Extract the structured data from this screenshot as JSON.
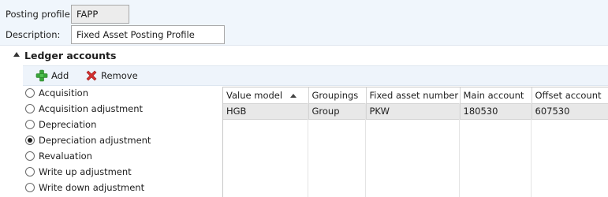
{
  "form": {
    "posting_profile_label": "Posting profile:",
    "posting_profile_value": "FAPP",
    "description_label": "Description:",
    "description_value": "Fixed Asset Posting Profile"
  },
  "section": {
    "title": "Ledger accounts"
  },
  "toolbar": {
    "add_label": "Add",
    "remove_label": "Remove"
  },
  "transaction_types": [
    {
      "label": "Acquisition",
      "selected": false
    },
    {
      "label": "Acquisition adjustment",
      "selected": false
    },
    {
      "label": "Depreciation",
      "selected": false
    },
    {
      "label": "Depreciation adjustment",
      "selected": true
    },
    {
      "label": "Revaluation",
      "selected": false
    },
    {
      "label": "Write up adjustment",
      "selected": false
    },
    {
      "label": "Write down adjustment",
      "selected": false
    }
  ],
  "grid": {
    "columns": [
      "Value model",
      "Groupings",
      "Fixed asset number",
      "Main account",
      "Offset account"
    ],
    "sorted_column": "Value model",
    "rows": [
      [
        "HGB",
        "Group",
        "PKW",
        "180530",
        "607530"
      ]
    ]
  },
  "colors": {
    "form_background": "#f0f6fc",
    "toolbar_background": "#eef4fb",
    "selected_row": "#e8e8e8",
    "add_icon": "#3aa53a",
    "remove_icon": "#d43030"
  }
}
